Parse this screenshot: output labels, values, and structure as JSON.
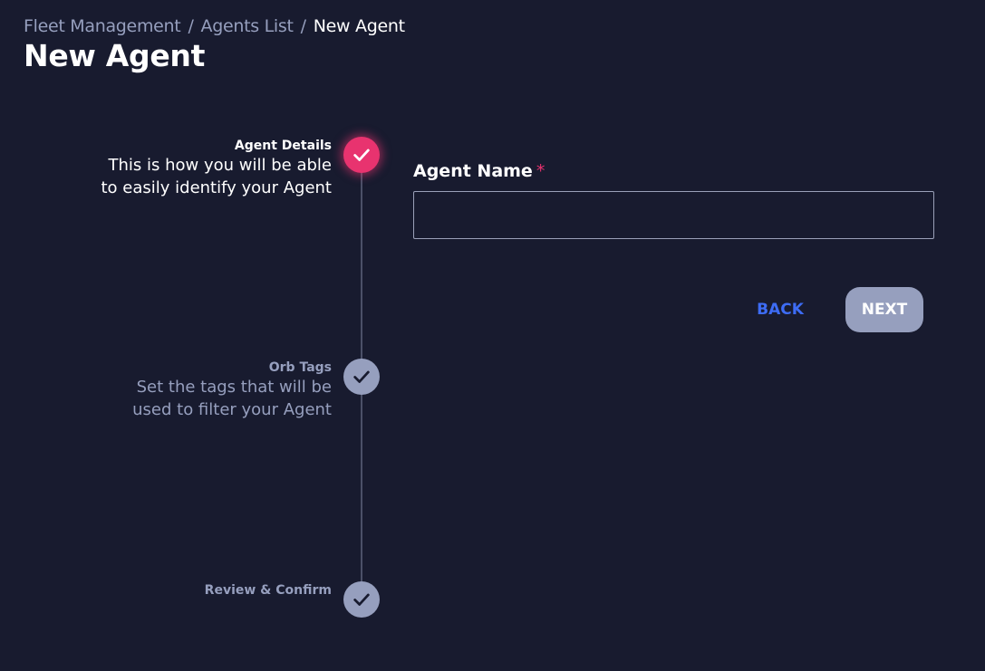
{
  "breadcrumb": {
    "items": [
      "Fleet Management",
      "Agents List"
    ],
    "separator": "/",
    "current": "New Agent"
  },
  "page_title": "New Agent",
  "stepper": {
    "steps": [
      {
        "title": "Agent Details",
        "description_line1": "This is how you will be able",
        "description_line2": "to easily identify your Agent",
        "state": "active",
        "icon": "check-icon"
      },
      {
        "title": "Orb Tags",
        "description_line1": "Set the tags that will be",
        "description_line2": "used to filter your Agent",
        "state": "inactive",
        "icon": "check-icon"
      },
      {
        "title": "Review & Confirm",
        "state": "inactive",
        "icon": "check-icon"
      }
    ]
  },
  "form": {
    "agent_name_label": "Agent Name",
    "required_marker": "*",
    "agent_name_value": "",
    "agent_name_placeholder": ""
  },
  "actions": {
    "back_label": "BACK",
    "next_label": "NEXT"
  },
  "colors": {
    "background": "#181b2f",
    "accent": "#e8336f",
    "link_blue": "#3d6cf5",
    "muted": "#969fbe"
  }
}
